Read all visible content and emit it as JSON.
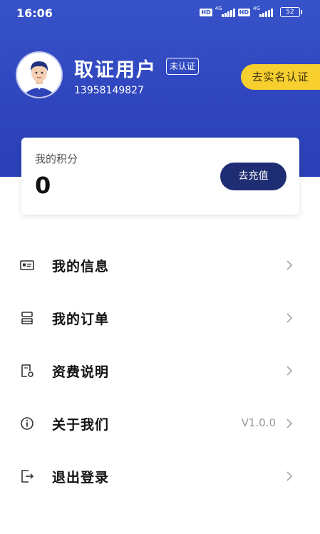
{
  "status_bar": {
    "time": "16:06",
    "hd": "HD",
    "network": "4G",
    "battery": "52"
  },
  "profile": {
    "name": "取证用户",
    "badge": "未认证",
    "phone": "13958149827",
    "verify_button": "去实名认证"
  },
  "points": {
    "label": "我的积分",
    "value": "0",
    "recharge_button": "去充值"
  },
  "menu": [
    {
      "label": "我的信息",
      "icon": "id-card-icon",
      "value": ""
    },
    {
      "label": "我的订单",
      "icon": "order-icon",
      "value": ""
    },
    {
      "label": "资费说明",
      "icon": "pricing-doc-icon",
      "value": ""
    },
    {
      "label": "关于我们",
      "icon": "info-icon",
      "value": "V1.0.0"
    },
    {
      "label": "退出登录",
      "icon": "logout-icon",
      "value": ""
    }
  ],
  "colors": {
    "header": "#3450c6",
    "accent_yellow": "#f7cf2f",
    "button_dark": "#1f2d73"
  }
}
